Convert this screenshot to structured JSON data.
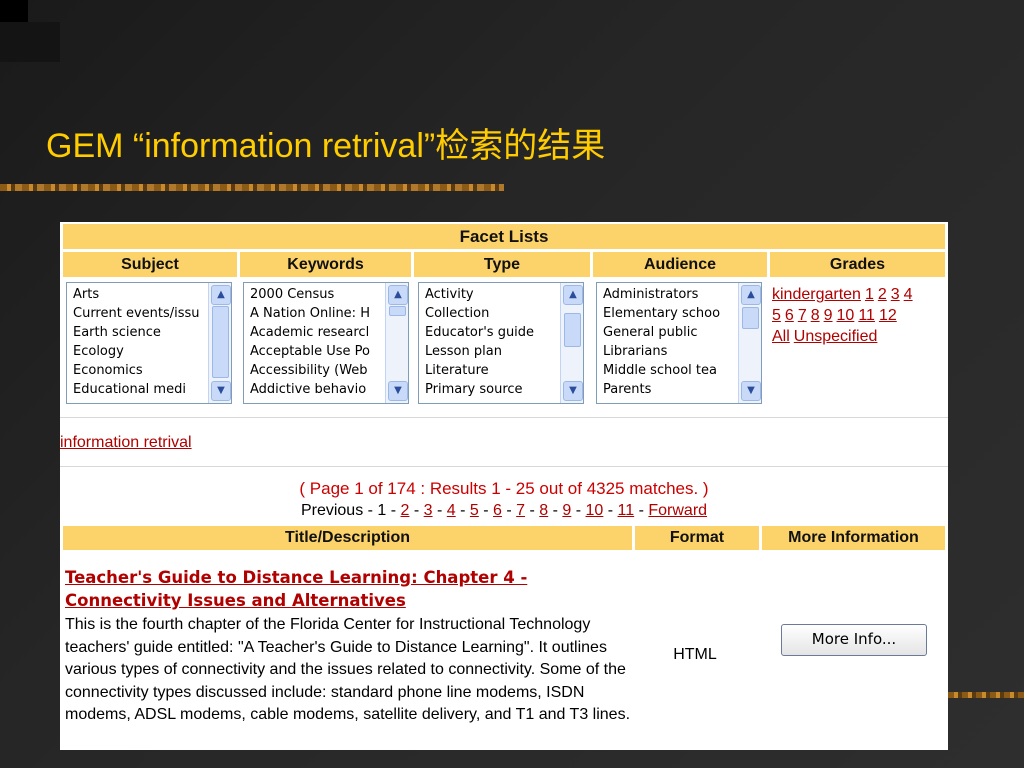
{
  "slide": {
    "title": "GEM “information retrival”检索的结果"
  },
  "facets": {
    "header": "Facet Lists",
    "columns": [
      {
        "label": "Subject",
        "items": [
          "Arts",
          "Current events/issu",
          "Earth science",
          "Ecology",
          "Economics",
          "Educational medi"
        ]
      },
      {
        "label": "Keywords",
        "items": [
          "2000 Census",
          "A Nation Online: H",
          "Academic researcl",
          "Acceptable Use Po",
          "Accessibility (Web",
          "Addictive behavio"
        ]
      },
      {
        "label": "Type",
        "items": [
          "Activity",
          "Collection",
          "Educator's guide",
          "Lesson plan",
          "Literature",
          "Primary source"
        ]
      },
      {
        "label": "Audience",
        "items": [
          "Administrators",
          "Elementary schoo",
          "General public",
          "Librarians",
          "Middle school tea",
          "Parents"
        ]
      },
      {
        "label": "Grades"
      }
    ],
    "grades": [
      "kindergarten",
      "1",
      "2",
      "3",
      "4",
      "5",
      "6",
      "7",
      "8",
      "9",
      "10",
      "11",
      "12",
      "All",
      "Unspecified"
    ]
  },
  "query": "information retrival",
  "results": {
    "summary": "( Page 1 of 174 : Results 1 - 25 out of 4325 matches. )",
    "pager": {
      "previous": "Previous - 1 ",
      "pages": [
        "2",
        "3",
        "4",
        "5",
        "6",
        "7",
        "8",
        "9",
        "10",
        "11"
      ],
      "forward": "Forward"
    },
    "headers": [
      "Title/Description",
      "Format",
      "More Information"
    ],
    "entry": {
      "title": "Teacher's Guide to Distance Learning: Chapter 4 - Connectivity Issues and Alternatives",
      "description": "This is the fourth chapter of the Florida Center for Instructional Technology teachers' guide entitled: \"A Teacher's Guide to Distance Learning\". It outlines various types of connectivity and the issues related to connectivity. Some of the connectivity types discussed include: standard phone line modems, ISDN modems, ADSL modems, cable modems, satellite delivery, and T1 and T3 lines.",
      "format": "HTML",
      "button": "More Info..."
    }
  },
  "colors": {
    "title": "#ffcc00",
    "header_bg": "#fcd36a",
    "link": "#b00000",
    "summary": "#cc0000"
  },
  "icons": [
    "scroll-up-icon",
    "scroll-down-icon"
  ]
}
